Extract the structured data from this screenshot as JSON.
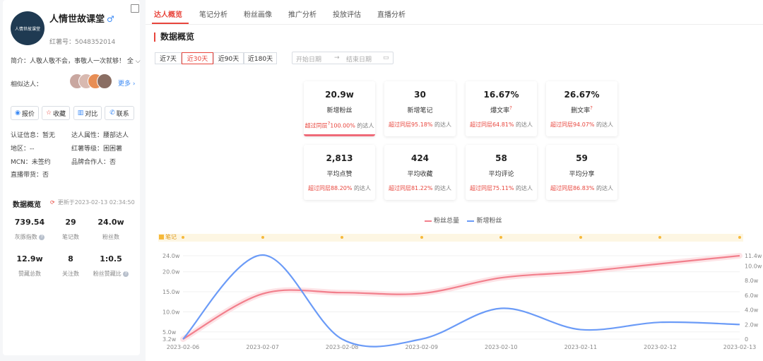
{
  "profile": {
    "avatar_text": "人情世故课堂",
    "name": "人情世故课堂",
    "gender_symbol": "♂",
    "red_id": "红薯号：5048352014",
    "intro": "简介：人敬人敬不会，事敬人一次就够！ 全",
    "similar_label": "相似达人：",
    "more_label": "更多",
    "buttons": [
      "报价",
      "收藏",
      "对比",
      "联系"
    ],
    "info": {
      "cert": "认证信息：暂无",
      "attr": "达人属性：腰部达人",
      "region": "地区：--",
      "level": "红薯等级：困困薯",
      "mcn": "MCN：未签约",
      "brand": "品牌合作人：否",
      "live": "直播带货：否"
    },
    "overview_title": "数据概览",
    "updated": "更新于2023-02-13 02:34:50",
    "stats": [
      {
        "value": "739.54",
        "label": "灰豚指数"
      },
      {
        "value": "29",
        "label": "笔记数"
      },
      {
        "value": "24.0w",
        "label": "粉丝数"
      },
      {
        "value": "12.9w",
        "label": "赞藏总数"
      },
      {
        "value": "8",
        "label": "关注数"
      },
      {
        "value": "1:0.5",
        "label": "粉丝赞藏比"
      }
    ]
  },
  "tabs": [
    "达人概览",
    "笔记分析",
    "粉丝画像",
    "推广分析",
    "投放评估",
    "直播分析"
  ],
  "section_title": "数据概览",
  "ranges": [
    "近7天",
    "近30天",
    "近90天",
    "近180天"
  ],
  "date": {
    "start": "开始日期",
    "arrow": "→",
    "end": "结束日期"
  },
  "cards": [
    {
      "value": "20.9w",
      "label": "新增粉丝",
      "lead": "超过同层",
      "pct": "100.00%",
      "tail": "的达人",
      "help": "?"
    },
    {
      "value": "30",
      "label": "新增笔记",
      "lead": "超过同层",
      "pct": "95.18%",
      "tail": "的达人",
      "help": ""
    },
    {
      "value": "16.67%",
      "label": "爆文率",
      "lead": "超过同层",
      "pct": "64.81%",
      "tail": "的达人",
      "help": "?"
    },
    {
      "value": "26.67%",
      "label": "删文率",
      "lead": "超过同层",
      "pct": "94.07%",
      "tail": "的达人",
      "help": "?"
    },
    {
      "value": "2,813",
      "label": "平均点赞",
      "lead": "超过同层",
      "pct": "88.20%",
      "tail": "的达人",
      "help": ""
    },
    {
      "value": "424",
      "label": "平均收藏",
      "lead": "超过同层",
      "pct": "81.22%",
      "tail": "的达人",
      "help": ""
    },
    {
      "value": "58",
      "label": "平均评论",
      "lead": "超过同层",
      "pct": "75.11%",
      "tail": "的达人",
      "help": ""
    },
    {
      "value": "59",
      "label": "平均分享",
      "lead": "超过同层",
      "pct": "86.83%",
      "tail": "的达人",
      "help": ""
    }
  ],
  "chart_notes_label": "笔记",
  "chart_data": {
    "type": "line",
    "x": [
      "2023-02-06",
      "2023-02-07",
      "2023-02-08",
      "2023-02-09",
      "2023-02-10",
      "2023-02-11",
      "2023-02-12",
      "2023-02-13"
    ],
    "series": [
      {
        "name": "粉丝总量",
        "axis": "left",
        "color": "#f27f8c",
        "values": [
          3.2,
          14.5,
          14.8,
          14.6,
          18.5,
          20.0,
          22.0,
          24.0
        ]
      },
      {
        "name": "新增粉丝",
        "axis": "right",
        "color": "#6b9bf7",
        "values": [
          0,
          11.5,
          0,
          0,
          4.2,
          1.3,
          2.3,
          2.0
        ]
      }
    ],
    "left_ticks": [
      "24.0w",
      "20.0w",
      "15.0w",
      "10.0w",
      "5.0w",
      "3.2w"
    ],
    "left_tick_values": [
      24.0,
      20.0,
      15.0,
      10.0,
      5.0,
      3.2
    ],
    "right_ticks": [
      "11.4w",
      "10.0w",
      "8.0w",
      "6.0w",
      "4.0w",
      "2.0w",
      "0"
    ],
    "right_tick_values": [
      11.4,
      10.0,
      8.0,
      6.0,
      4.0,
      2.0,
      0
    ],
    "ylim_left": [
      3.2,
      24.0
    ],
    "ylim_right": [
      0,
      11.4
    ],
    "grid": true,
    "legend_position": "top-center"
  }
}
